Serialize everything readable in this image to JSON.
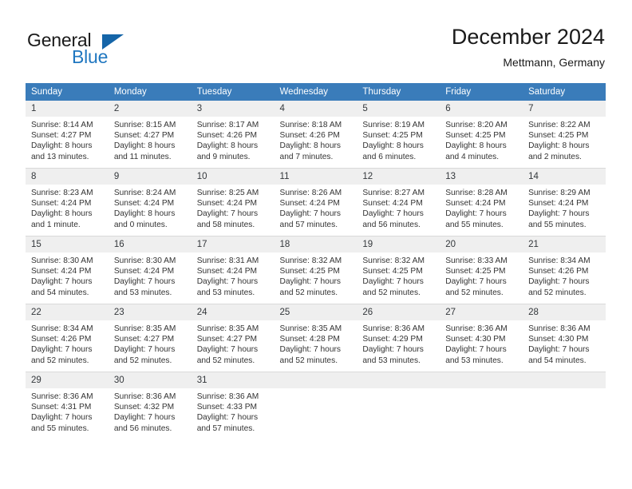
{
  "brand": {
    "name_top": "General",
    "name_bottom": "Blue",
    "triangle_icon": "triangle-icon",
    "color_top": "#1a1a1a",
    "color_bottom": "#2077c0",
    "triangle_color": "#1565a8"
  },
  "header": {
    "title": "December 2024",
    "subtitle": "Mettmann, Germany"
  },
  "theme": {
    "header_bg": "#3a7cba",
    "header_text": "#ffffff",
    "daynum_bg": "#efefef",
    "cell_border": "#d9d9d9",
    "body_text": "#333333"
  },
  "weekdays": [
    "Sunday",
    "Monday",
    "Tuesday",
    "Wednesday",
    "Thursday",
    "Friday",
    "Saturday"
  ],
  "weeks": [
    [
      {
        "day": "1",
        "sunrise": "Sunrise: 8:14 AM",
        "sunset": "Sunset: 4:27 PM",
        "daylight1": "Daylight: 8 hours",
        "daylight2": "and 13 minutes."
      },
      {
        "day": "2",
        "sunrise": "Sunrise: 8:15 AM",
        "sunset": "Sunset: 4:27 PM",
        "daylight1": "Daylight: 8 hours",
        "daylight2": "and 11 minutes."
      },
      {
        "day": "3",
        "sunrise": "Sunrise: 8:17 AM",
        "sunset": "Sunset: 4:26 PM",
        "daylight1": "Daylight: 8 hours",
        "daylight2": "and 9 minutes."
      },
      {
        "day": "4",
        "sunrise": "Sunrise: 8:18 AM",
        "sunset": "Sunset: 4:26 PM",
        "daylight1": "Daylight: 8 hours",
        "daylight2": "and 7 minutes."
      },
      {
        "day": "5",
        "sunrise": "Sunrise: 8:19 AM",
        "sunset": "Sunset: 4:25 PM",
        "daylight1": "Daylight: 8 hours",
        "daylight2": "and 6 minutes."
      },
      {
        "day": "6",
        "sunrise": "Sunrise: 8:20 AM",
        "sunset": "Sunset: 4:25 PM",
        "daylight1": "Daylight: 8 hours",
        "daylight2": "and 4 minutes."
      },
      {
        "day": "7",
        "sunrise": "Sunrise: 8:22 AM",
        "sunset": "Sunset: 4:25 PM",
        "daylight1": "Daylight: 8 hours",
        "daylight2": "and 2 minutes."
      }
    ],
    [
      {
        "day": "8",
        "sunrise": "Sunrise: 8:23 AM",
        "sunset": "Sunset: 4:24 PM",
        "daylight1": "Daylight: 8 hours",
        "daylight2": "and 1 minute."
      },
      {
        "day": "9",
        "sunrise": "Sunrise: 8:24 AM",
        "sunset": "Sunset: 4:24 PM",
        "daylight1": "Daylight: 8 hours",
        "daylight2": "and 0 minutes."
      },
      {
        "day": "10",
        "sunrise": "Sunrise: 8:25 AM",
        "sunset": "Sunset: 4:24 PM",
        "daylight1": "Daylight: 7 hours",
        "daylight2": "and 58 minutes."
      },
      {
        "day": "11",
        "sunrise": "Sunrise: 8:26 AM",
        "sunset": "Sunset: 4:24 PM",
        "daylight1": "Daylight: 7 hours",
        "daylight2": "and 57 minutes."
      },
      {
        "day": "12",
        "sunrise": "Sunrise: 8:27 AM",
        "sunset": "Sunset: 4:24 PM",
        "daylight1": "Daylight: 7 hours",
        "daylight2": "and 56 minutes."
      },
      {
        "day": "13",
        "sunrise": "Sunrise: 8:28 AM",
        "sunset": "Sunset: 4:24 PM",
        "daylight1": "Daylight: 7 hours",
        "daylight2": "and 55 minutes."
      },
      {
        "day": "14",
        "sunrise": "Sunrise: 8:29 AM",
        "sunset": "Sunset: 4:24 PM",
        "daylight1": "Daylight: 7 hours",
        "daylight2": "and 55 minutes."
      }
    ],
    [
      {
        "day": "15",
        "sunrise": "Sunrise: 8:30 AM",
        "sunset": "Sunset: 4:24 PM",
        "daylight1": "Daylight: 7 hours",
        "daylight2": "and 54 minutes."
      },
      {
        "day": "16",
        "sunrise": "Sunrise: 8:30 AM",
        "sunset": "Sunset: 4:24 PM",
        "daylight1": "Daylight: 7 hours",
        "daylight2": "and 53 minutes."
      },
      {
        "day": "17",
        "sunrise": "Sunrise: 8:31 AM",
        "sunset": "Sunset: 4:24 PM",
        "daylight1": "Daylight: 7 hours",
        "daylight2": "and 53 minutes."
      },
      {
        "day": "18",
        "sunrise": "Sunrise: 8:32 AM",
        "sunset": "Sunset: 4:25 PM",
        "daylight1": "Daylight: 7 hours",
        "daylight2": "and 52 minutes."
      },
      {
        "day": "19",
        "sunrise": "Sunrise: 8:32 AM",
        "sunset": "Sunset: 4:25 PM",
        "daylight1": "Daylight: 7 hours",
        "daylight2": "and 52 minutes."
      },
      {
        "day": "20",
        "sunrise": "Sunrise: 8:33 AM",
        "sunset": "Sunset: 4:25 PM",
        "daylight1": "Daylight: 7 hours",
        "daylight2": "and 52 minutes."
      },
      {
        "day": "21",
        "sunrise": "Sunrise: 8:34 AM",
        "sunset": "Sunset: 4:26 PM",
        "daylight1": "Daylight: 7 hours",
        "daylight2": "and 52 minutes."
      }
    ],
    [
      {
        "day": "22",
        "sunrise": "Sunrise: 8:34 AM",
        "sunset": "Sunset: 4:26 PM",
        "daylight1": "Daylight: 7 hours",
        "daylight2": "and 52 minutes."
      },
      {
        "day": "23",
        "sunrise": "Sunrise: 8:35 AM",
        "sunset": "Sunset: 4:27 PM",
        "daylight1": "Daylight: 7 hours",
        "daylight2": "and 52 minutes."
      },
      {
        "day": "24",
        "sunrise": "Sunrise: 8:35 AM",
        "sunset": "Sunset: 4:27 PM",
        "daylight1": "Daylight: 7 hours",
        "daylight2": "and 52 minutes."
      },
      {
        "day": "25",
        "sunrise": "Sunrise: 8:35 AM",
        "sunset": "Sunset: 4:28 PM",
        "daylight1": "Daylight: 7 hours",
        "daylight2": "and 52 minutes."
      },
      {
        "day": "26",
        "sunrise": "Sunrise: 8:36 AM",
        "sunset": "Sunset: 4:29 PM",
        "daylight1": "Daylight: 7 hours",
        "daylight2": "and 53 minutes."
      },
      {
        "day": "27",
        "sunrise": "Sunrise: 8:36 AM",
        "sunset": "Sunset: 4:30 PM",
        "daylight1": "Daylight: 7 hours",
        "daylight2": "and 53 minutes."
      },
      {
        "day": "28",
        "sunrise": "Sunrise: 8:36 AM",
        "sunset": "Sunset: 4:30 PM",
        "daylight1": "Daylight: 7 hours",
        "daylight2": "and 54 minutes."
      }
    ],
    [
      {
        "day": "29",
        "sunrise": "Sunrise: 8:36 AM",
        "sunset": "Sunset: 4:31 PM",
        "daylight1": "Daylight: 7 hours",
        "daylight2": "and 55 minutes."
      },
      {
        "day": "30",
        "sunrise": "Sunrise: 8:36 AM",
        "sunset": "Sunset: 4:32 PM",
        "daylight1": "Daylight: 7 hours",
        "daylight2": "and 56 minutes."
      },
      {
        "day": "31",
        "sunrise": "Sunrise: 8:36 AM",
        "sunset": "Sunset: 4:33 PM",
        "daylight1": "Daylight: 7 hours",
        "daylight2": "and 57 minutes."
      },
      {
        "day": "",
        "sunrise": "",
        "sunset": "",
        "daylight1": "",
        "daylight2": ""
      },
      {
        "day": "",
        "sunrise": "",
        "sunset": "",
        "daylight1": "",
        "daylight2": ""
      },
      {
        "day": "",
        "sunrise": "",
        "sunset": "",
        "daylight1": "",
        "daylight2": ""
      },
      {
        "day": "",
        "sunrise": "",
        "sunset": "",
        "daylight1": "",
        "daylight2": ""
      }
    ]
  ]
}
